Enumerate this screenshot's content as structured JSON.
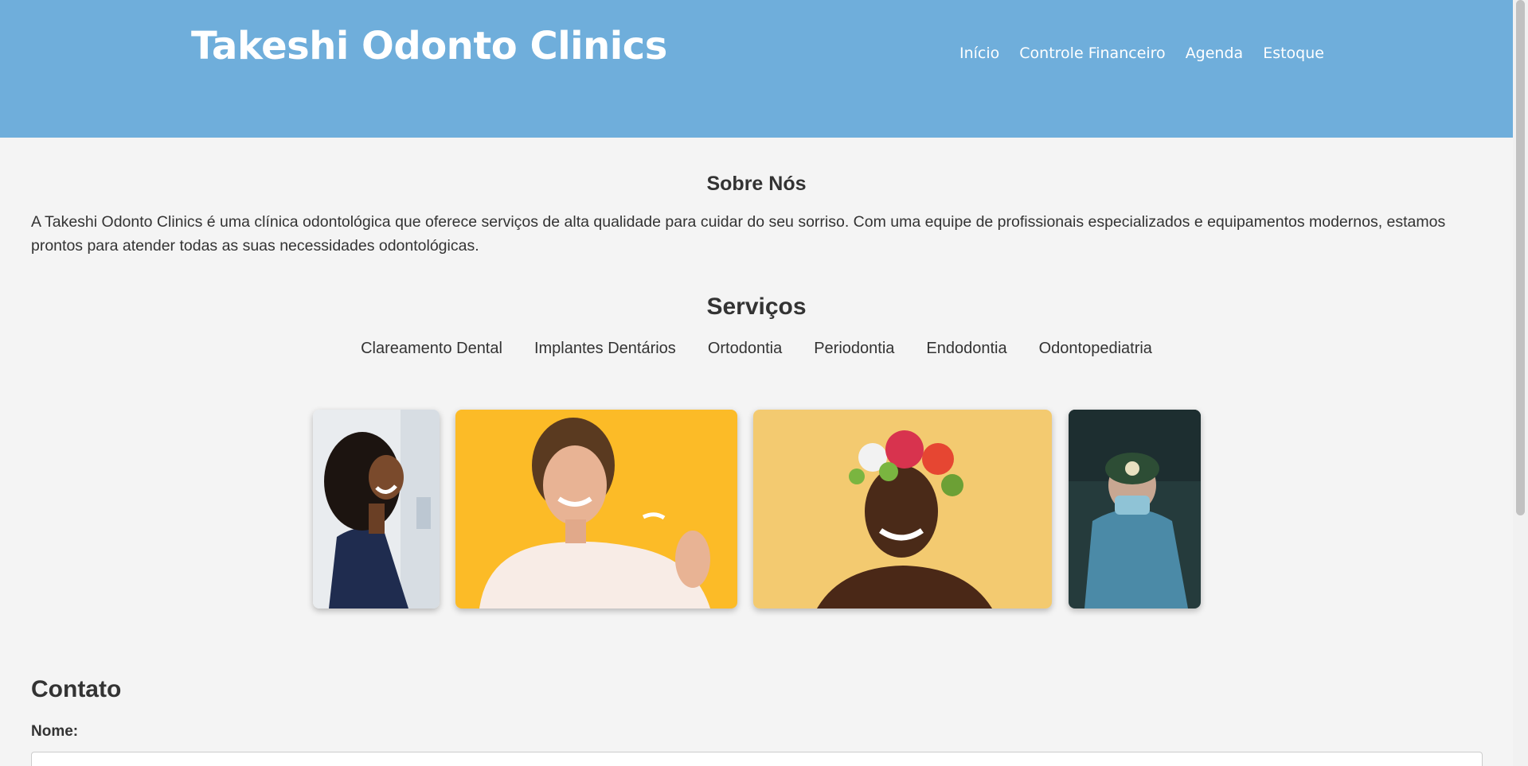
{
  "header": {
    "brand": "Takeshi Odonto Clinics",
    "nav": [
      "Início",
      "Controle Financeiro",
      "Agenda",
      "Estoque"
    ],
    "background_color": "#6faedb"
  },
  "about": {
    "title": "Sobre Nós",
    "text": "A Takeshi Odonto Clinics é uma clínica odontológica que oferece serviços de alta qualidade para cuidar do seu sorriso. Com uma equipe de profissionais especializados e equipamentos modernos, estamos prontos para atender todas as suas necessidades odontológicas."
  },
  "services": {
    "title": "Serviços",
    "items": [
      "Clareamento Dental",
      "Implantes Dentários",
      "Ortodontia",
      "Periodontia",
      "Endodontia",
      "Odontopediatria"
    ]
  },
  "gallery": {
    "photos": [
      "smiling-woman-photo",
      "woman-holding-aligner-photo",
      "woman-flower-crown-photo",
      "dental-surgeon-photo"
    ]
  },
  "contact": {
    "title": "Contato",
    "name_label": "Nome:",
    "name_value": ""
  }
}
